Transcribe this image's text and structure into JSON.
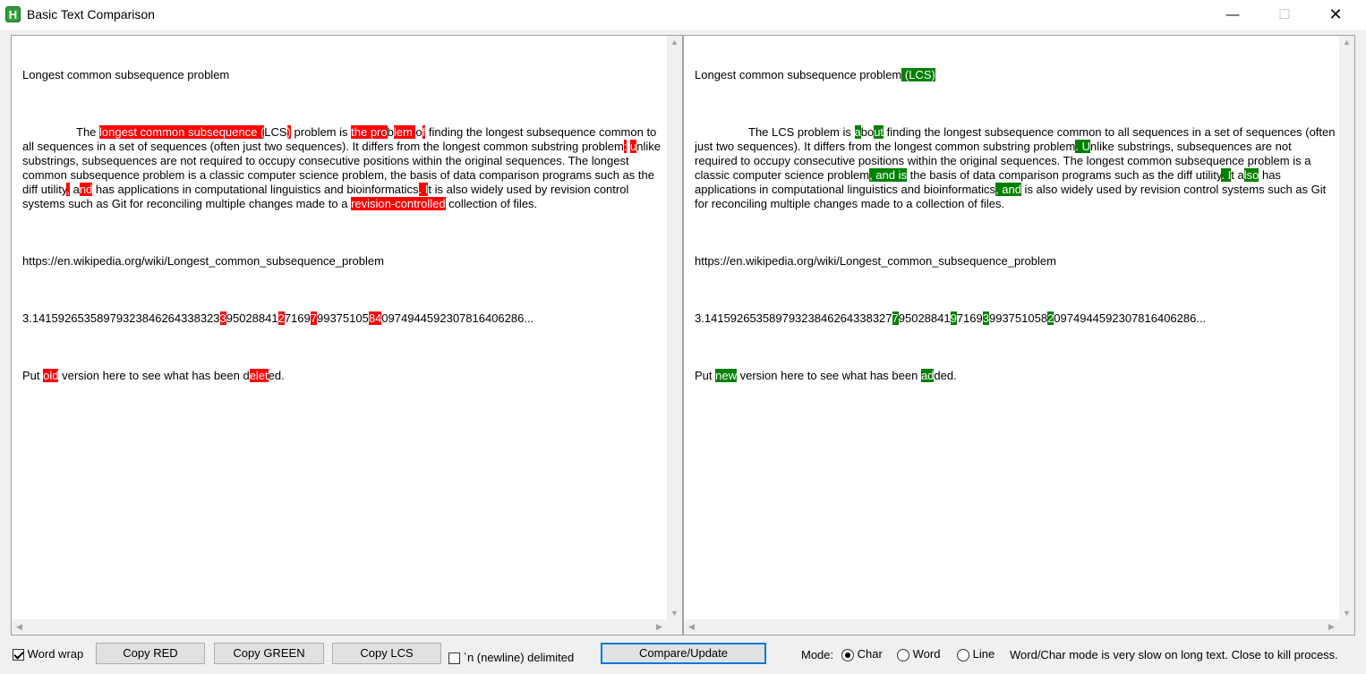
{
  "window": {
    "title": "Basic Text Comparison",
    "minimize_glyph": "—",
    "maximize_glyph": "☐",
    "close_glyph": "✕"
  },
  "left_pane": {
    "line1": "Longest common subsequence problem",
    "para": [
      {
        "t": "The "
      },
      {
        "t": "longest common subsequence (",
        "d": 1
      },
      {
        "t": "LCS"
      },
      {
        "t": ")",
        "d": 1
      },
      {
        "t": " problem is "
      },
      {
        "t": "the pro",
        "d": 1
      },
      {
        "t": "b"
      },
      {
        "t": "lem ",
        "d": 1
      },
      {
        "t": "o"
      },
      {
        "t": "f",
        "d": 1
      },
      {
        "t": " finding the longest subsequence common to all sequences in a set of sequences (often just two sequences). It differs from the longest common substring problem"
      },
      {
        "t": ":",
        "d": 1
      },
      {
        "t": " "
      },
      {
        "t": "u",
        "d": 1
      },
      {
        "t": "nlike substrings, subsequences are not required to occupy consecutive positions within the original sequences. The longest common subsequence problem is a classic computer science problem, the basis of data comparison programs such as the diff utility"
      },
      {
        "t": ",",
        "d": 1
      },
      {
        "t": " a"
      },
      {
        "t": "nd",
        "d": 1
      },
      {
        "t": " has applications in computational linguistics and bioinformatics"
      },
      {
        "t": ". I",
        "d": 1
      },
      {
        "t": "t is also widely used by revision control systems such as Git for reconciling multiple changes made to a "
      },
      {
        "t": "revision-controlled",
        "d": 1
      },
      {
        "t": " collection of files."
      }
    ],
    "url": "https://en.wikipedia.org/wiki/Longest_common_subsequence_problem",
    "pi": [
      {
        "t": "3.14159265358979323846264338323"
      },
      {
        "t": "3",
        "d": 1
      },
      {
        "t": "95028841"
      },
      {
        "t": "2",
        "d": 1
      },
      {
        "t": "7169"
      },
      {
        "t": "7",
        "d": 1
      },
      {
        "t": "99375105"
      },
      {
        "t": "8",
        "d": 1
      },
      {
        "t": "4",
        "d": 1
      },
      {
        "t": "0974944592307816406286..."
      }
    ],
    "last": [
      {
        "t": "Put "
      },
      {
        "t": "old",
        "d": 1
      },
      {
        "t": " version here to see what has been d"
      },
      {
        "t": "elet",
        "d": 1
      },
      {
        "t": "ed."
      }
    ]
  },
  "right_pane": {
    "line1": [
      {
        "t": "Longest common subsequence problem"
      },
      {
        "t": " (LCS)",
        "a": 1
      }
    ],
    "para": [
      {
        "t": "The LCS problem is "
      },
      {
        "t": "a",
        "a": 1
      },
      {
        "t": "bo"
      },
      {
        "t": "ut",
        "a": 1
      },
      {
        "t": " finding the longest subsequence common to all sequences in a set of sequences (often just two sequences). It differs from the longest common substring problem"
      },
      {
        "t": ". U",
        "a": 1
      },
      {
        "t": "nlike substrings, subsequences are not required to occupy consecutive positions within the original sequences. The longest common subsequence problem is a classic computer science problem"
      },
      {
        "t": ", and is",
        "a": 1
      },
      {
        "t": " the basis of data comparison programs such as the diff utility"
      },
      {
        "t": ". I",
        "a": 1
      },
      {
        "t": "t a"
      },
      {
        "t": "lso",
        "a": 1
      },
      {
        "t": " has applications in computational linguistics and bioinformatics"
      },
      {
        "t": ", and",
        "a": 1
      },
      {
        "t": " is also widely used by revision control systems such as Git for reconciling multiple changes made to a collection of files."
      }
    ],
    "url": "https://en.wikipedia.org/wiki/Longest_common_subsequence_problem",
    "pi": [
      {
        "t": "3.14159265358979323846264338327"
      },
      {
        "t": "7",
        "a": 1
      },
      {
        "t": "95028841"
      },
      {
        "t": "9",
        "a": 1
      },
      {
        "t": "7169"
      },
      {
        "t": "3",
        "a": 1
      },
      {
        "t": "99375105"
      },
      {
        "t": "8"
      },
      {
        "t": "2",
        "a": 1
      },
      {
        "t": "0974944592307816406286..."
      }
    ],
    "last": [
      {
        "t": "Put "
      },
      {
        "t": "new",
        "a": 1
      },
      {
        "t": " version here to see what has been "
      },
      {
        "t": "ad",
        "a": 1
      },
      {
        "t": "ded."
      }
    ]
  },
  "controls": {
    "word_wrap_label": "Word wrap",
    "copy_red": "Copy RED",
    "copy_green": "Copy GREEN",
    "copy_lcs": "Copy LCS",
    "newline_label": "`n (newline) delimited",
    "compare_button": "Compare/Update",
    "mode_label": "Mode:",
    "mode_options": [
      "Char",
      "Word",
      "Line"
    ],
    "mode_selected": "Char",
    "note": "Word/Char mode is very slow on long text. Close to kill process."
  },
  "colors": {
    "deleted": "#ff0000",
    "added": "#008000",
    "focus": "#0078d7"
  },
  "icons": {
    "app": "H"
  }
}
